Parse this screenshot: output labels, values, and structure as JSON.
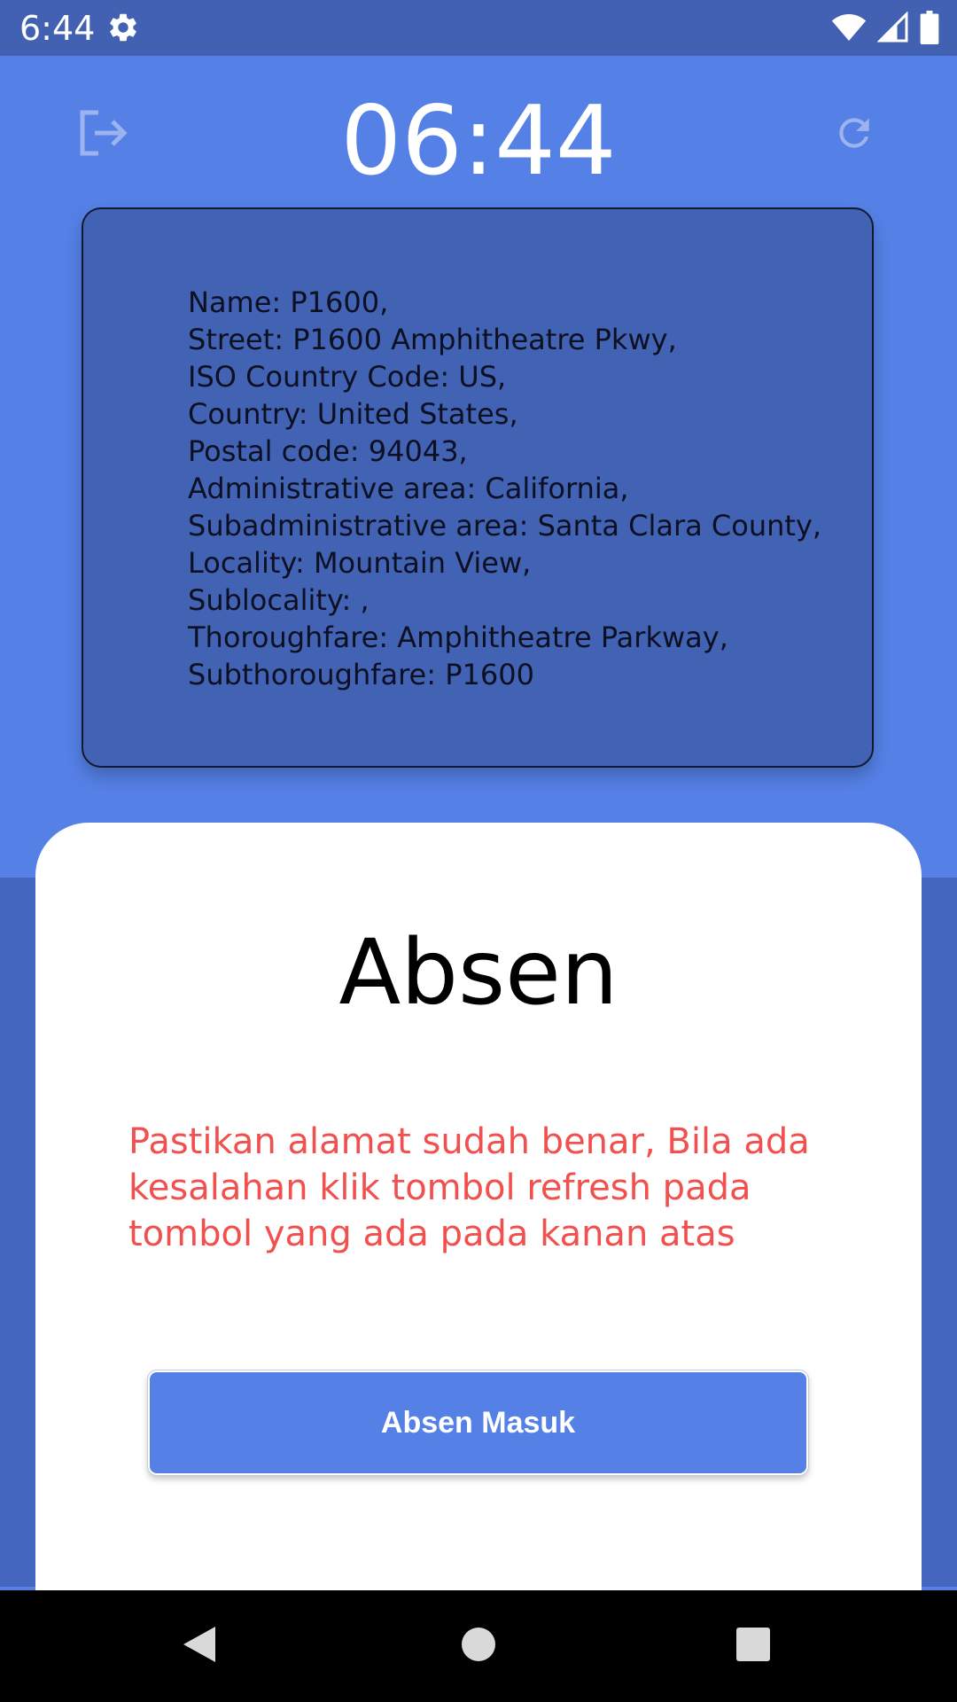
{
  "status_bar": {
    "time": "6:44",
    "icons": [
      "gear-icon",
      "wifi-icon",
      "signal-icon",
      "battery-icon"
    ]
  },
  "header": {
    "clock": "06:44",
    "logout_icon": "logout-icon",
    "refresh_icon": "refresh-icon"
  },
  "address": {
    "lines": [
      "Name: P1600,",
      "Street: P1600 Amphitheatre Pkwy,",
      "ISO Country Code: US,",
      "Country: United States,",
      "Postal code: 94043,",
      "Administrative area: California,",
      "Subadministrative area: Santa Clara County,",
      "Locality: Mountain View,",
      "Sublocality: ,",
      "Thoroughfare: Amphitheatre Parkway,",
      "Subthoroughfare: P1600"
    ]
  },
  "panel": {
    "title": "Absen",
    "warning": "Pastikan alamat sudah benar, Bila ada kesalahan klik tombol refresh pada tombol yang ada pada kanan atas",
    "button_label": "Absen Masuk"
  },
  "nav": {
    "icons": [
      "back-icon",
      "home-icon",
      "recents-icon"
    ]
  },
  "colors": {
    "primary": "#5580E6",
    "status_bar": "#4261B3",
    "card": "#4262B4",
    "warning": "#F2504F"
  }
}
